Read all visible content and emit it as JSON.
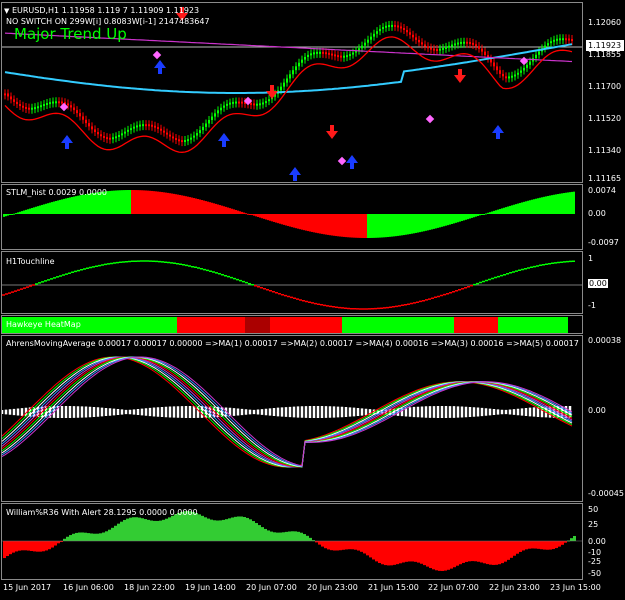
{
  "header": {
    "symbol_line": "EURUSD,H1  1.11958 1.119 7 1.11909 1.11923",
    "switch_line": "NO SWITCH ON  299W[i] 0.8083W[i-1] 2147483647",
    "trend_text": "Major Trend Up"
  },
  "price_scale": {
    "labels": [
      "1.12060",
      "1.11923",
      "1.11855",
      "1.11700",
      "1.11520",
      "1.11340",
      "1.11165"
    ],
    "current_price": "1.11923"
  },
  "panes": {
    "stlm": {
      "title": "STLM_hist 0.0029 0.0000",
      "scale": [
        "0.0074",
        "0.00",
        "-0.0097"
      ]
    },
    "touchline": {
      "title": "H1Touchline",
      "scale": [
        "1",
        "0.00",
        "-1"
      ]
    },
    "heatmap": {
      "title": "Hawkeye HeatMap"
    },
    "ahrens": {
      "title": "AhrensMovingAverage 0.00017 0.00017 0.00000  =>MA(1) 0.00017  =>MA(2) 0.00017  =>MA(4) 0.00016  =>MA(3) 0.00016  =>MA(5) 0.00017",
      "scale": [
        "0.00038",
        "0.00",
        "-0.00045"
      ]
    },
    "williams": {
      "title": "William%R36 With Alert 28.1295 0.0000 0.0000",
      "scale": [
        "50",
        "25",
        "0.00",
        "-10",
        "-25",
        "-50"
      ]
    }
  },
  "x_axis": [
    "15 Jun 2017",
    "16 Jun 06:00",
    "18 Jun 22:00",
    "19 Jun 14:00",
    "20 Jun 07:00",
    "20 Jun 23:00",
    "21 Jun 15:00",
    "22 Jun 07:00",
    "22 Jun 23:00",
    "23 Jun 15:00"
  ],
  "colors": {
    "bull": "#00ff00",
    "bear": "#ff0000",
    "ma_cyan": "#33ccff",
    "ma_magenta": "#cc33cc",
    "grid": "#8a8a8a"
  }
}
